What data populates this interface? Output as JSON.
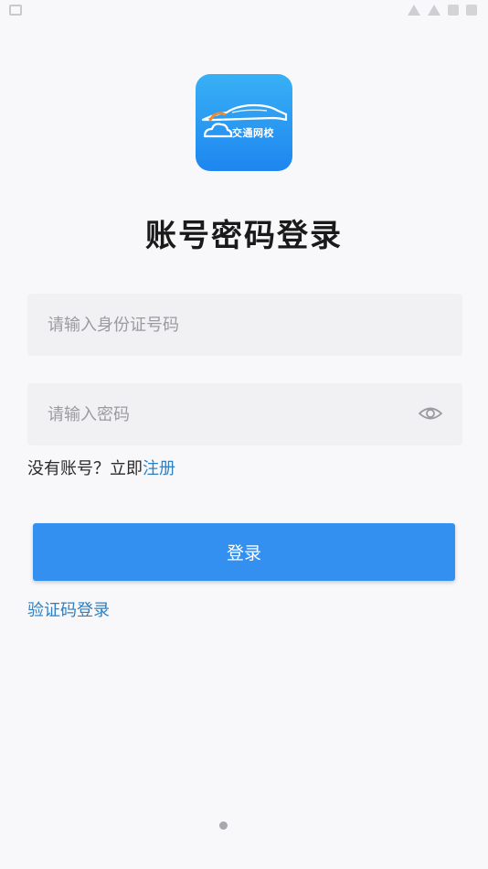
{
  "app": {
    "logo_text": "交通网校",
    "brand_color": "#3390f0"
  },
  "page": {
    "title": "账号密码登录"
  },
  "form": {
    "id_placeholder": "请输入身份证号码",
    "password_placeholder": "请输入密码",
    "id_value": "",
    "password_value": ""
  },
  "register": {
    "prompt": "没有账号？立即",
    "link_label": "注册"
  },
  "buttons": {
    "login_label": "登录"
  },
  "links": {
    "code_login_label": "验证码登录"
  },
  "icons": {
    "password_toggle": "eye-icon"
  }
}
